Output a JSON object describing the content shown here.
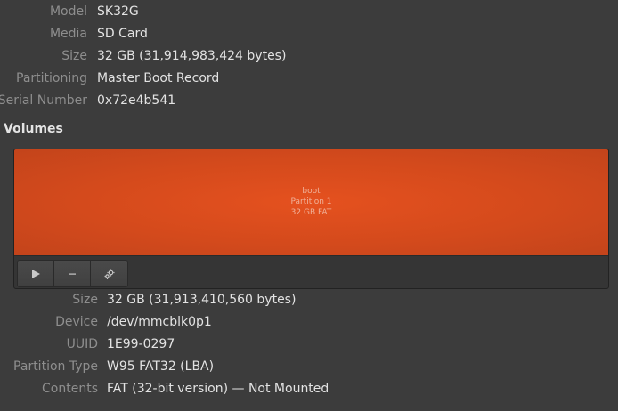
{
  "drive": {
    "rows": [
      {
        "label": "Model",
        "value": "SK32G"
      },
      {
        "label": "Media",
        "value": "SD Card"
      },
      {
        "label": "Size",
        "value": "32 GB (31,914,983,424 bytes)"
      },
      {
        "label": "Partitioning",
        "value": "Master Boot Record"
      },
      {
        "label": "Serial Number",
        "value": "0x72e4b541"
      }
    ]
  },
  "volumes": {
    "title": "Volumes",
    "partition": {
      "name": "boot",
      "number": "Partition 1",
      "summary": "32 GB FAT",
      "color": "#e0501f"
    },
    "toolbar": {
      "mount_icon": "play-icon",
      "remove_icon": "minus-icon",
      "settings_icon": "gears-icon"
    }
  },
  "details": {
    "rows": [
      {
        "label": "Size",
        "value": "32 GB (31,913,410,560 bytes)"
      },
      {
        "label": "Device",
        "value": "/dev/mmcblk0p1"
      },
      {
        "label": "UUID",
        "value": "1E99-0297"
      },
      {
        "label": "Partition Type",
        "value": "W95 FAT32 (LBA)"
      },
      {
        "label": "Contents",
        "value": "FAT (32-bit version) — Not Mounted"
      }
    ]
  }
}
